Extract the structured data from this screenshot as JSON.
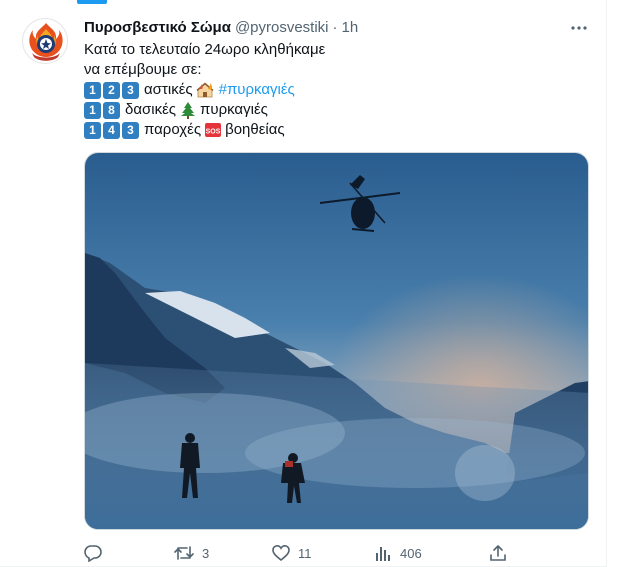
{
  "tweet": {
    "author_name": "Πυροσβεστικό Σώμα",
    "author_handle": "@pyrosvestiki",
    "separator": "·",
    "time": "1h",
    "line1": "Κατά το τελευταίο 24ωρο κληθήκαμε",
    "line2": "να επέμβουμε σε:",
    "stats": [
      {
        "digits": [
          "1",
          "2",
          "3"
        ],
        "text_before": "αστικές",
        "emoji": "house-fire-emoji",
        "hashtag": "#πυρκαγιές",
        "text_after": ""
      },
      {
        "digits": [
          "1",
          "8"
        ],
        "text_before": "δασικές",
        "emoji": "evergreen-tree-emoji",
        "hashtag": "",
        "text_after": "πυρκαγιές"
      },
      {
        "digits": [
          "1",
          "4",
          "3"
        ],
        "text_before": "παροχές",
        "emoji": "sos-emoji",
        "sos_label": "SOS",
        "hashtag": "",
        "text_after": "βοηθείας"
      }
    ]
  },
  "media": {
    "description_icon": "photo-helicopter-mountain-rescue"
  },
  "actions": {
    "reply_count": "",
    "retweet_count": "3",
    "like_count": "11",
    "views_count": "406"
  },
  "colors": {
    "accent": "#1d9bf0",
    "keycap": "#2f7fc1",
    "muted": "#536471",
    "text": "#0f1419"
  }
}
